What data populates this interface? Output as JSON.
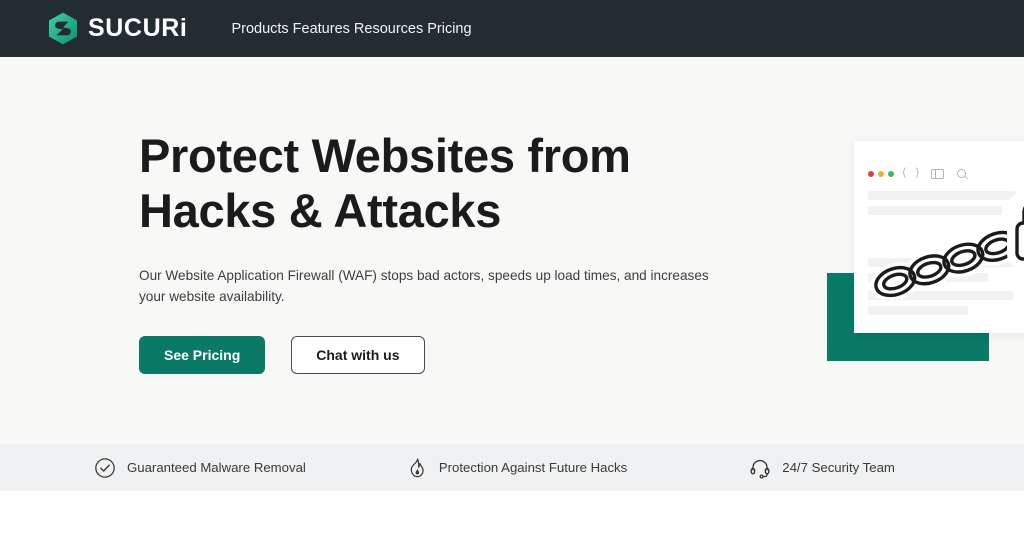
{
  "nav": {
    "brand": {
      "name": "SUCURi",
      "logo_icon": "sucuri-hex-s-logo",
      "logo_color": "#2bbd95"
    },
    "links": [
      {
        "label": "Products"
      },
      {
        "label": "Features"
      },
      {
        "label": "Resources"
      },
      {
        "label": "Pricing"
      }
    ],
    "background_color": "#232d31"
  },
  "hero": {
    "title_line1": "Protect Websites from",
    "title_line2": "Hacks & Attacks",
    "subtitle": "Our Website Application Firewall (WAF) stops bad actors, speeds up load times, and increases your website availability.",
    "primary_button": {
      "label": "See Pricing",
      "background_color": "#0a7a66",
      "text_color": "#ffffff"
    },
    "secondary_button": {
      "label": "Chat with us",
      "background_color": "#ffffff",
      "text_color": "#1b1b1b"
    },
    "background_color": "#f8f8f7",
    "illustration": {
      "accent_color": "#097a66",
      "browser_dots": [
        "#d8453d",
        "#e6b32e",
        "#41b85a"
      ],
      "icons": [
        "chevron-left-icon",
        "chevron-right-icon",
        "sidebar-icon",
        "search-icon",
        "chain-link-icon",
        "padlock-icon"
      ]
    }
  },
  "features": {
    "background_color": "#f0f1f2",
    "items": [
      {
        "icon": "check-circle-icon",
        "label": "Guaranteed Malware Removal"
      },
      {
        "icon": "flame-icon",
        "label": "Protection Against Future Hacks"
      },
      {
        "icon": "headset-icon",
        "label": "24/7 Security Team"
      }
    ]
  }
}
